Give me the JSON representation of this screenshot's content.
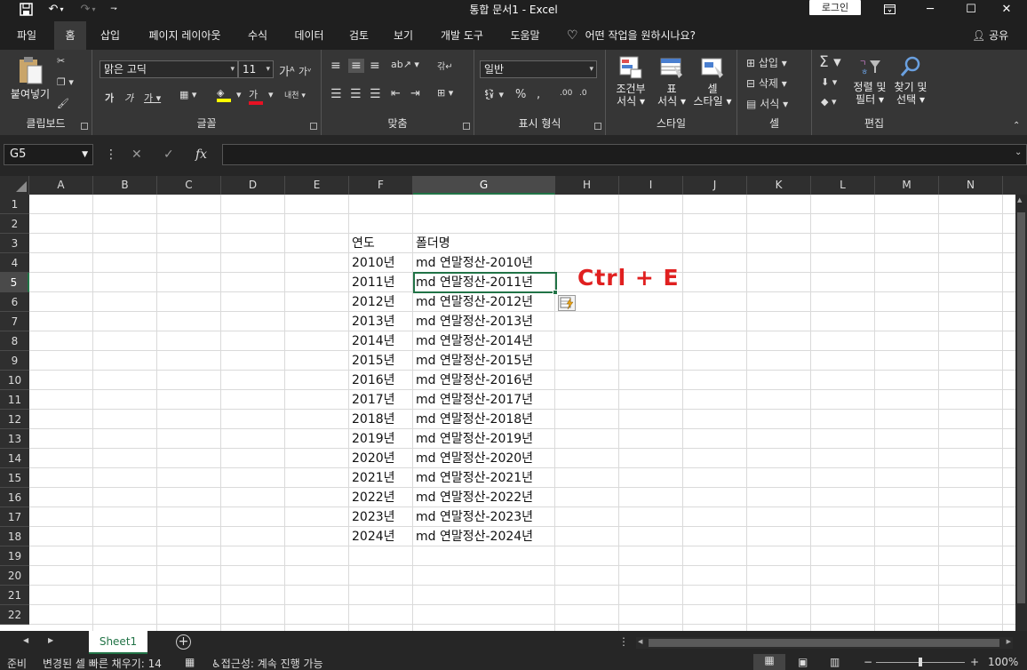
{
  "window": {
    "title": "통합 문서1  -  Excel",
    "login_label": "로그인"
  },
  "menu": {
    "tabs": [
      "파일",
      "홈",
      "삽입",
      "페이지 레이아웃",
      "수식",
      "데이터",
      "검토",
      "보기",
      "개발 도구",
      "도움말"
    ],
    "active": "홈",
    "tell_me": "어떤 작업을 원하시나요?",
    "share": "공유"
  },
  "ribbon": {
    "clipboard": {
      "paste_label": "붙여넣기",
      "group_label": "클립보드"
    },
    "font": {
      "font_name": "맑은 고딕",
      "font_size": "11",
      "group_label": "글꼴"
    },
    "alignment": {
      "group_label": "맞춤"
    },
    "number": {
      "format": "일반",
      "group_label": "표시 형식"
    },
    "styles": {
      "conditional": "조건부",
      "conditional2": "서식",
      "table": "표",
      "table2": "서식",
      "cell": "셀",
      "cell2": "스타일",
      "group_label": "스타일"
    },
    "cells": {
      "insert": "삽입",
      "delete": "삭제",
      "format": "서식",
      "group_label": "셀"
    },
    "editing": {
      "sort": "정렬 및",
      "sort2": "필터",
      "find": "찾기 및",
      "find2": "선택",
      "group_label": "편집"
    }
  },
  "formula_bar": {
    "name_box": "G5",
    "formula": ""
  },
  "grid": {
    "columns": [
      "A",
      "B",
      "C",
      "D",
      "E",
      "F",
      "G",
      "H",
      "I",
      "J",
      "K",
      "L",
      "M",
      "N"
    ],
    "rows": [
      "1",
      "2",
      "3",
      "4",
      "5",
      "6",
      "7",
      "8",
      "9",
      "10",
      "11",
      "12",
      "13",
      "14",
      "15",
      "16",
      "17",
      "18",
      "19",
      "20",
      "21",
      "22"
    ],
    "selected_column": "G",
    "selected_row": "5",
    "header_f": "연도",
    "header_g": "폴더명",
    "years": [
      "2010년",
      "2011년",
      "2012년",
      "2013년",
      "2014년",
      "2015년",
      "2016년",
      "2017년",
      "2018년",
      "2019년",
      "2020년",
      "2021년",
      "2022년",
      "2023년",
      "2024년"
    ],
    "folders": [
      "md 연말정산-2010년",
      "md 연말정산-2011년",
      "md 연말정산-2012년",
      "md 연말정산-2013년",
      "md 연말정산-2014년",
      "md 연말정산-2015년",
      "md 연말정산-2016년",
      "md 연말정산-2017년",
      "md 연말정산-2018년",
      "md 연말정산-2019년",
      "md 연말정산-2020년",
      "md 연말정산-2021년",
      "md 연말정산-2022년",
      "md 연말정산-2023년",
      "md 연말정산-2024년"
    ]
  },
  "annotation": "Ctrl + E",
  "sheet_tabs": {
    "active": "Sheet1"
  },
  "status_bar": {
    "ready": "준비",
    "flash_fill": "변경된 셀 빠른 채우기: 14",
    "accessibility": "접근성: 계속 진행 가능",
    "zoom": "100%"
  },
  "colors": {
    "accent": "#217346",
    "annotation": "#e02020"
  }
}
